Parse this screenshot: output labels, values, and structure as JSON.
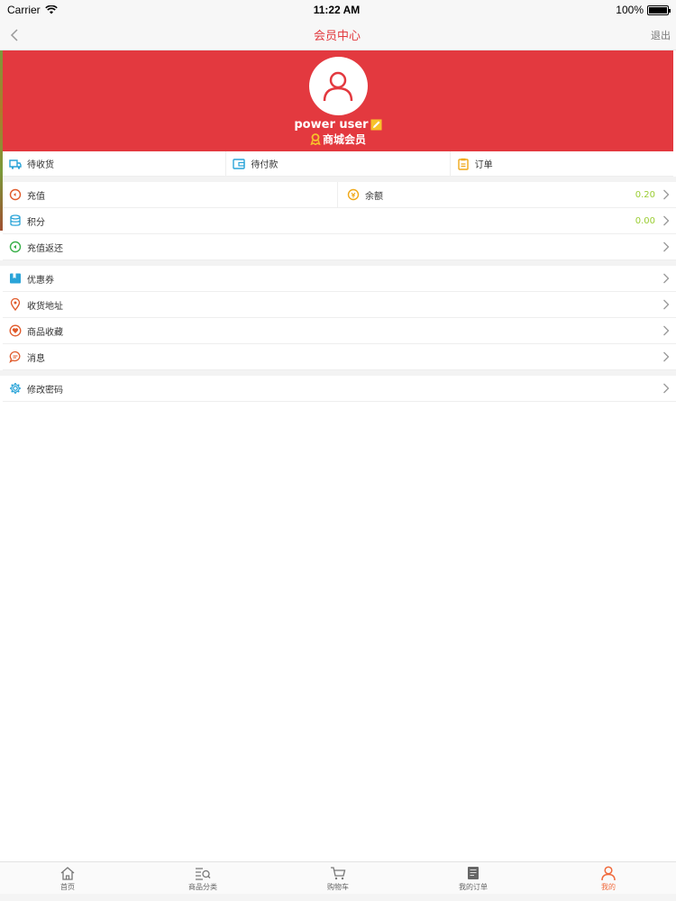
{
  "status_bar": {
    "carrier": "Carrier",
    "time": "11:22 AM",
    "battery": "100%",
    "battery_level": 1.0
  },
  "header": {
    "title": "会员中心",
    "logout": "退出"
  },
  "profile": {
    "username": "power user",
    "level": "商城会员"
  },
  "orders": [
    {
      "label": "待收货",
      "icon": "truck-icon"
    },
    {
      "label": "待付款",
      "icon": "wallet-icon"
    },
    {
      "label": "订单",
      "icon": "clipboard-icon"
    }
  ],
  "finance": {
    "recharge": "充值",
    "balance_label": "余额",
    "balance_value": "0.20",
    "points_label": "积分",
    "points_value": "0.00",
    "refund_label": "充值返还"
  },
  "menu": [
    {
      "label": "优惠券",
      "icon": "coupon-icon"
    },
    {
      "label": "收货地址",
      "icon": "location-icon"
    },
    {
      "label": "商品收藏",
      "icon": "heart-icon"
    },
    {
      "label": "消息",
      "icon": "message-icon"
    }
  ],
  "settings": {
    "label": "修改密码",
    "icon": "gear-icon"
  },
  "tabbar": [
    {
      "label": "首页",
      "icon": "home-icon"
    },
    {
      "label": "商品分类",
      "icon": "category-icon"
    },
    {
      "label": "购物车",
      "icon": "cart-icon"
    },
    {
      "label": "我的订单",
      "icon": "orders-icon"
    },
    {
      "label": "我的",
      "icon": "user-icon",
      "active": true
    }
  ],
  "colors": {
    "brand": "#e3393f",
    "accent_orange": "#f06a3c",
    "value_green": "#9acd32"
  }
}
